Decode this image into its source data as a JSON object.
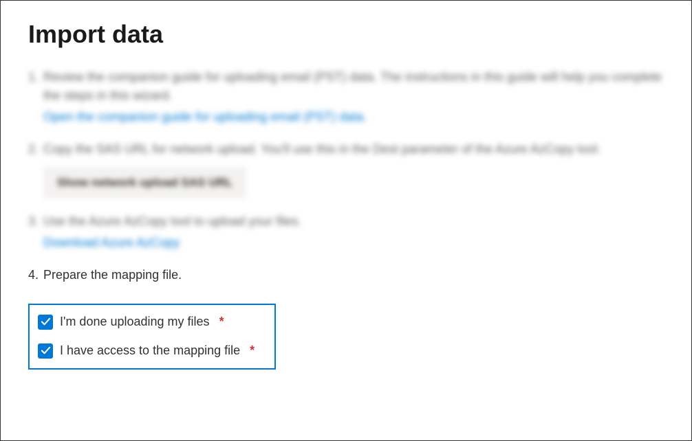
{
  "page": {
    "title": "Import data"
  },
  "steps": {
    "s1": {
      "num": "1.",
      "text": "Review the companion guide for uploading email (PST) data. The instructions in this guide will help you complete the steps in this wizard.",
      "link": "Open the companion guide for uploading email (PST) data."
    },
    "s2": {
      "num": "2.",
      "text": "Copy the SAS URL for network upload. You'll use this in the Dest parameter of the Azure AzCopy tool.",
      "button": "Show network upload SAS URL"
    },
    "s3": {
      "num": "3.",
      "text": "Use the Azure AzCopy tool to upload your files.",
      "link": "Download Azure AzCopy"
    },
    "s4": {
      "num": "4.",
      "text": "Prepare the mapping file."
    }
  },
  "checkboxes": {
    "done_uploading": {
      "label": "I'm done uploading my files",
      "checked": true,
      "required": "*"
    },
    "have_mapping": {
      "label": "I have access to the mapping file",
      "checked": true,
      "required": "*"
    }
  }
}
